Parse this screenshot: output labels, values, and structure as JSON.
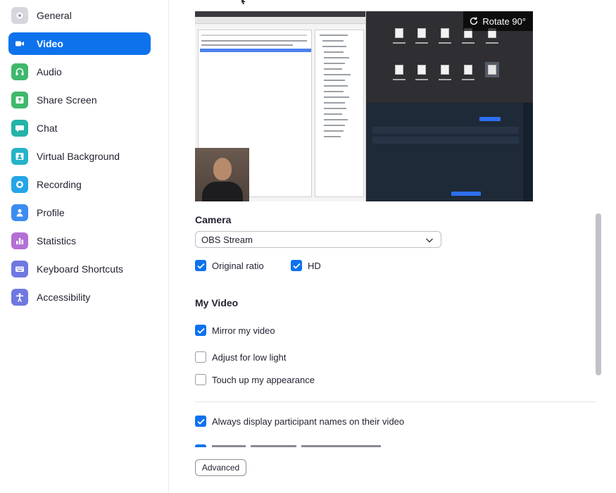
{
  "sidebar": {
    "items": [
      {
        "label": "General",
        "icon": "gear-icon",
        "color": "#8b8b96",
        "active": false
      },
      {
        "label": "Video",
        "icon": "video-camera-icon",
        "color": "#0e72ed",
        "active": true
      },
      {
        "label": "Audio",
        "icon": "headphones-icon",
        "color": "#3fb86b",
        "active": false
      },
      {
        "label": "Share Screen",
        "icon": "share-screen-icon",
        "color": "#3fb86b",
        "active": false
      },
      {
        "label": "Chat",
        "icon": "chat-bubble-icon",
        "color": "#24b3a8",
        "active": false
      },
      {
        "label": "Virtual Background",
        "icon": "virtual-background-icon",
        "color": "#24b3c7",
        "active": false
      },
      {
        "label": "Recording",
        "icon": "record-icon",
        "color": "#24a5e8",
        "active": false
      },
      {
        "label": "Profile",
        "icon": "person-icon",
        "color": "#3d8cf0",
        "active": false
      },
      {
        "label": "Statistics",
        "icon": "bar-chart-icon",
        "color": "#b36fd6",
        "active": false
      },
      {
        "label": "Keyboard Shortcuts",
        "icon": "keyboard-icon",
        "color": "#6f78e0",
        "active": false
      },
      {
        "label": "Accessibility",
        "icon": "accessibility-icon",
        "color": "#6f78e0",
        "active": false
      }
    ]
  },
  "preview": {
    "rotate_label": "Rotate 90°"
  },
  "camera": {
    "heading": "Camera",
    "selected": "OBS Stream",
    "original_ratio": {
      "label": "Original ratio",
      "checked": true
    },
    "hd": {
      "label": "HD",
      "checked": true
    }
  },
  "my_video": {
    "heading": "My Video",
    "mirror": {
      "label": "Mirror my video",
      "checked": true
    },
    "low_light": {
      "label": "Adjust for low light",
      "checked": false
    },
    "touch_up": {
      "label": "Touch up my appearance",
      "checked": false
    }
  },
  "names": {
    "always_display": {
      "label": "Always display participant names on their video",
      "checked": true
    }
  },
  "advanced_label": "Advanced",
  "colors": {
    "accent": "#0e72ed",
    "text": "#232333"
  }
}
